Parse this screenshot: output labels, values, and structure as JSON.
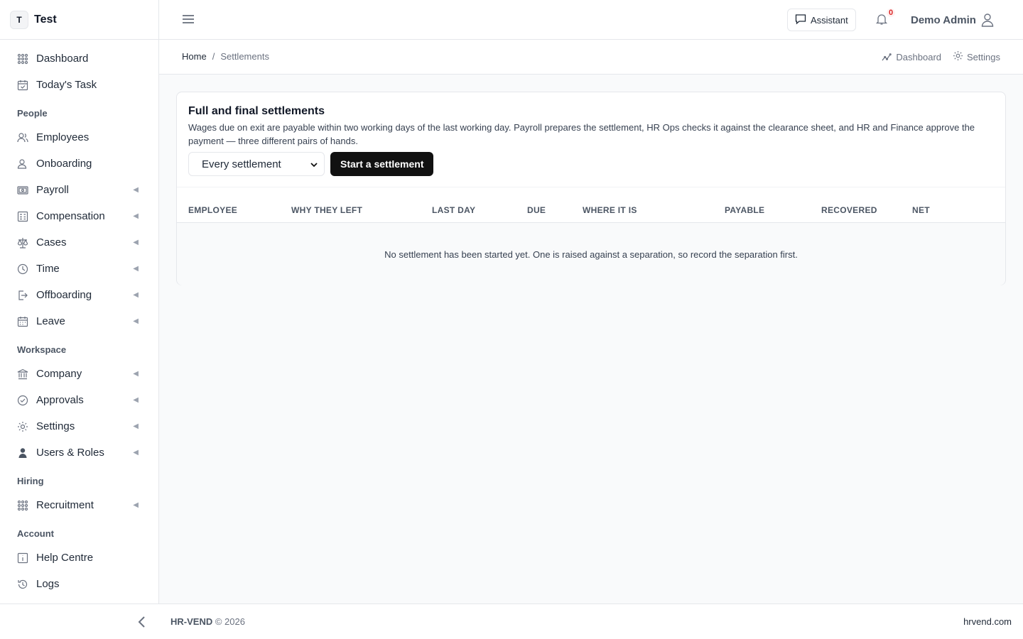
{
  "brand": {
    "badge": "T",
    "name": "Test"
  },
  "sidebar": {
    "top": [
      {
        "label": "Dashboard",
        "icon": "grid-icon"
      },
      {
        "label": "Today's Task",
        "icon": "calendar-check-icon"
      }
    ],
    "sections": [
      {
        "title": "People",
        "items": [
          {
            "label": "Employees",
            "icon": "users-icon",
            "chevron": false
          },
          {
            "label": "Onboarding",
            "icon": "user-plus-icon",
            "chevron": false
          },
          {
            "label": "Payroll",
            "icon": "banknote-icon",
            "chevron": true
          },
          {
            "label": "Compensation",
            "icon": "calculator-icon",
            "chevron": true
          },
          {
            "label": "Cases",
            "icon": "scale-icon",
            "chevron": true
          },
          {
            "label": "Time",
            "icon": "clock-icon",
            "chevron": true
          },
          {
            "label": "Offboarding",
            "icon": "logout-icon",
            "chevron": true
          },
          {
            "label": "Leave",
            "icon": "calendar-icon",
            "chevron": true
          }
        ]
      },
      {
        "title": "Workspace",
        "items": [
          {
            "label": "Company",
            "icon": "bank-icon",
            "chevron": true
          },
          {
            "label": "Approvals",
            "icon": "check-circle-icon",
            "chevron": true
          },
          {
            "label": "Settings",
            "icon": "gear-icon",
            "chevron": true
          },
          {
            "label": "Users & Roles",
            "icon": "user-shield-icon",
            "chevron": true
          }
        ]
      },
      {
        "title": "Hiring",
        "items": [
          {
            "label": "Recruitment",
            "icon": "grid-icon",
            "chevron": true
          }
        ]
      },
      {
        "title": "Account",
        "items": [
          {
            "label": "Help Centre",
            "icon": "info-icon",
            "chevron": false
          },
          {
            "label": "Logs",
            "icon": "history-icon",
            "chevron": false
          }
        ]
      }
    ]
  },
  "topbar": {
    "assistant_label": "Assistant",
    "notification_count": "0",
    "user_name": "Demo Admin"
  },
  "breadcrumb": {
    "home": "Home",
    "separator": "/",
    "current": "Settlements"
  },
  "quick_links": {
    "dashboard": "Dashboard",
    "settings": "Settings"
  },
  "card": {
    "title": "Full and final settlements",
    "description": "Wages due on exit are payable within two working days of the last working day. Payroll prepares the settlement, HR Ops checks it against the clearance sheet, and HR and Finance approve the payment — three different pairs of hands.",
    "filter_value": "Every settlement",
    "start_button": "Start a settlement",
    "columns": [
      "EMPLOYEE",
      "WHY THEY LEFT",
      "LAST DAY",
      "DUE",
      "WHERE IT IS",
      "PAYABLE",
      "RECOVERED",
      "NET"
    ],
    "empty_message": "No settlement has been started yet. One is raised against a separation, so record the separation first."
  },
  "footer": {
    "brand": "HR-VEND",
    "copyright": "© 2026",
    "site": "hrvend.com"
  }
}
